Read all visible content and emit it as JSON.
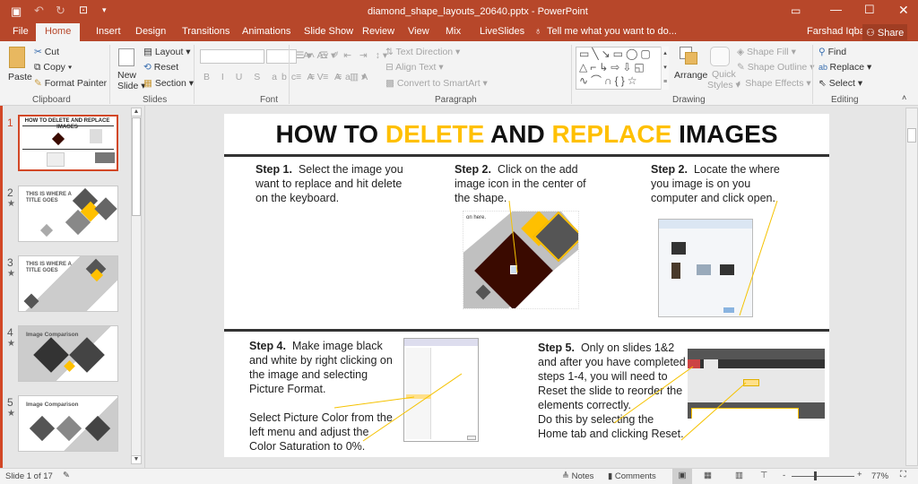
{
  "app": {
    "title": "diamond_shape_layouts_20640.pptx - PowerPoint",
    "user": "Farshad Iqbal",
    "share": "Share",
    "tell_me": "Tell me what you want to do..."
  },
  "tabs": [
    "File",
    "Home",
    "Insert",
    "Design",
    "Transitions",
    "Animations",
    "Slide Show",
    "Review",
    "View",
    "Mix",
    "LiveSlides"
  ],
  "ribbon": {
    "clipboard": {
      "label": "Clipboard",
      "paste": "Paste",
      "cut": "Cut",
      "copy": "Copy",
      "format_painter": "Format Painter"
    },
    "slides": {
      "label": "Slides",
      "new_slide": "New",
      "new_slide2": "Slide",
      "layout": "Layout",
      "reset": "Reset",
      "section": "Section"
    },
    "font": {
      "label": "Font"
    },
    "paragraph": {
      "label": "Paragraph",
      "text_direction": "Text Direction",
      "align_text": "Align Text",
      "convert": "Convert to SmartArt"
    },
    "drawing": {
      "label": "Drawing",
      "arrange": "Arrange",
      "quick_styles": "Quick",
      "quick_styles2": "Styles",
      "shape_fill": "Shape Fill",
      "shape_outline": "Shape Outline",
      "shape_effects": "Shape Effects"
    },
    "editing": {
      "label": "Editing",
      "find": "Find",
      "replace": "Replace",
      "select": "Select"
    }
  },
  "thumbnails": [
    {
      "num": "1",
      "title": "HOW TO DELETE AND REPLACE IMAGES"
    },
    {
      "num": "2",
      "title": "THIS IS WHERE A TITLE GOES"
    },
    {
      "num": "3",
      "title": "THIS IS WHERE A TITLE GOES"
    },
    {
      "num": "4",
      "title": "Image Comparison"
    },
    {
      "num": "5",
      "title": "Image Comparison"
    }
  ],
  "slide": {
    "title_parts": [
      "HOW TO ",
      "DELETE",
      " AND ",
      "REPLACE",
      " IMAGES"
    ],
    "accent": "#ffc000",
    "steps": [
      {
        "head": "Step 1.",
        "body": "Select the image you want to replace and hit delete on the keyboard."
      },
      {
        "head": "Step 2.",
        "body": "Click on the add image icon in the center of the shape."
      },
      {
        "head": "Step 2.",
        "body": "Locate the where you image is on you computer and click open."
      },
      {
        "head": "Step 4.",
        "body": "Make image black and white by right clicking on the image and selecting Picture Format.",
        "body2": "Select Picture Color from the left menu and adjust the Color Saturation to 0%."
      },
      {
        "head": "Step 5.",
        "body": "Only on slides 1&2 and after you have completed steps 1-4, you will need to Reset the slide to reorder the elements correctly.",
        "body2": "Do this by selecting the Home tab and clicking Reset."
      }
    ],
    "screenshot_text": "on here."
  },
  "status": {
    "slide": "Slide 1 of 17",
    "notes": "Notes",
    "comments": "Comments",
    "zoom": "77%",
    "zoom_level": 77
  }
}
